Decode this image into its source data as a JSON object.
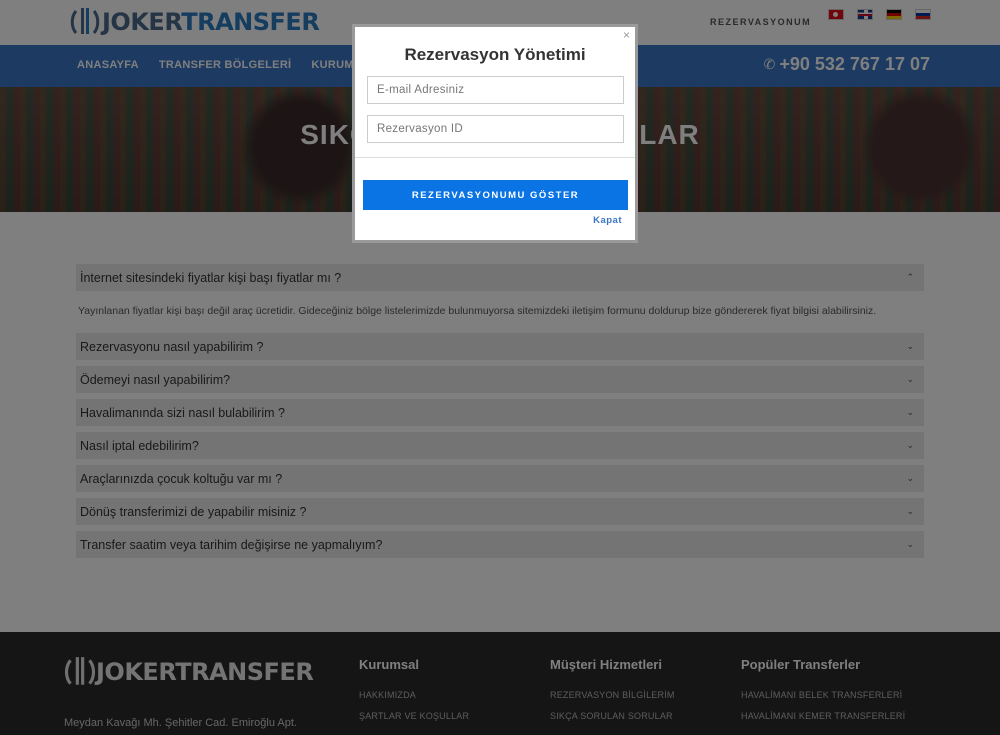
{
  "header": {
    "logo_joker": "JOKER",
    "logo_transfer": "TRANSFER",
    "reservation_link": "REZERVASYONUM",
    "flags": [
      "tr-flag",
      "en-flag",
      "de-flag",
      "ru-flag"
    ]
  },
  "nav": {
    "items": [
      "ANASAYFA",
      "TRANSFER BÖLGELERİ",
      "KURUMSAL"
    ],
    "phone": "+90 532 767 17 07"
  },
  "hero": {
    "title": "SIKÇA SORULAN SORULAR"
  },
  "faq": {
    "first_question": "İnternet sitesindeki fiyatlar kişi başı fiyatlar mı ?",
    "first_answer": "Yayınlanan fiyatlar kişi başı değil araç ücretidir. Gideceğiniz bölge listelerimizde bulunmuyorsa sitemizdeki iletişim formunu doldurup bize göndererek fiyat bilgisi alabilirsiniz.",
    "questions": [
      "Rezervasyonu nasıl yapabilirim ?",
      "Ödemeyi nasıl yapabilirim?",
      "Havalimanında sizi nasıl bulabilirim ?",
      "Nasıl iptal edebilirim?",
      "Araçlarınızda çocuk koltuğu var mı ?",
      "Dönüş transferimizi de yapabilir misiniz ?",
      "Transfer saatim veya tarihim değişirse ne yapmalıyım?"
    ]
  },
  "footer": {
    "logo": "JOKERTRANSFER",
    "address": "Meydan Kavağı Mh. Şehitler Cad. Emiroğlu Apt.",
    "columns": [
      {
        "title": "Kurumsal",
        "links": [
          "HAKKIMIZDA",
          "ŞARTLAR VE KOŞULLAR"
        ]
      },
      {
        "title": "Müşteri Hizmetleri",
        "links": [
          "REZERVASYON BİLGİLERİM",
          "SIKÇA SORULAN SORULAR"
        ]
      },
      {
        "title": "Popüler Transferler",
        "links": [
          "HAVALİMANI BELEK TRANSFERLERİ",
          "HAVALİMANI KEMER TRANSFERLERİ"
        ]
      }
    ]
  },
  "modal": {
    "close": "×",
    "title": "Rezervasyon Yönetimi",
    "email_placeholder": "E-mail Adresiniz",
    "id_placeholder": "Rezervasyon ID",
    "submit_label": "REZERVASYONUMU GÖSTER",
    "close_link": "Kapat"
  },
  "colors": {
    "nav_blue": "#3a75c4",
    "button_blue": "#0b74e5",
    "footer_bg": "#2a2a2a"
  }
}
